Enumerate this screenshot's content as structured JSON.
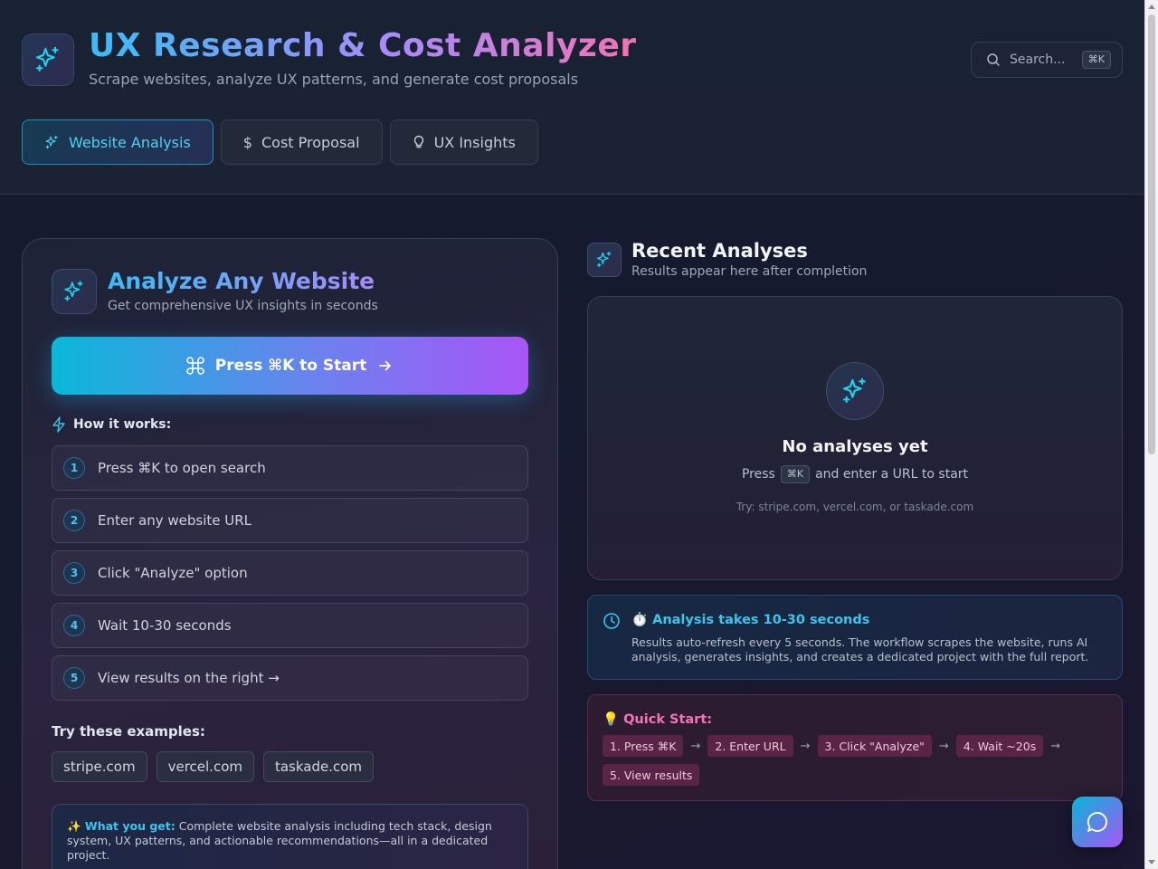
{
  "header": {
    "title": "UX Research & Cost Analyzer",
    "subtitle": "Scrape websites, analyze UX patterns, and generate cost proposals",
    "logo_icon": "sparkles-icon",
    "search": {
      "placeholder": "Search...",
      "shortcut": "⌘K"
    }
  },
  "tabs": [
    {
      "label": "Website Analysis",
      "icon": "sparkles-icon",
      "active": true
    },
    {
      "label": "Cost Proposal",
      "icon": "dollar-icon",
      "active": false
    },
    {
      "label": "UX Insights",
      "icon": "lightbulb-icon",
      "active": false
    }
  ],
  "analyze": {
    "title": "Analyze Any Website",
    "subtitle": "Get comprehensive UX insights in seconds",
    "cta_label": "Press ⌘K to Start",
    "how_label": "How it works:",
    "steps": [
      {
        "num": "1",
        "text": "Press ⌘K to open search"
      },
      {
        "num": "2",
        "text": "Enter any website URL"
      },
      {
        "num": "3",
        "text": "Click \"Analyze\" option"
      },
      {
        "num": "4",
        "text": "Wait 10-30 seconds"
      },
      {
        "num": "5",
        "text": "View results on the right →"
      }
    ],
    "examples_label": "Try these examples:",
    "examples": [
      "stripe.com",
      "vercel.com",
      "taskade.com"
    ],
    "get_label": "✨ What you get:",
    "get_text": "Complete website analysis including tech stack, design system, UX patterns, and actionable recommendations—all in a dedicated project."
  },
  "recent": {
    "title": "Recent Analyses",
    "subtitle": "Results appear here after completion",
    "empty_title": "No analyses yet",
    "empty_hint_pre": "Press",
    "empty_hint_key": "⌘K",
    "empty_hint_post": "and enter a URL to start",
    "empty_try": "Try: stripe.com, vercel.com, or taskade.com"
  },
  "timing": {
    "title": "⏱️ Analysis takes 10-30 seconds",
    "text": "Results auto-refresh every 5 seconds. The workflow scrapes the website, runs AI analysis, generates insights, and creates a dedicated project with the full report."
  },
  "quick_start": {
    "title": "💡 Quick Start:",
    "steps": [
      "1. Press ⌘K",
      "2. Enter URL",
      "3. Click \"Analyze\"",
      "4. Wait ~20s",
      "5. View results"
    ],
    "arrow": "→"
  },
  "colors": {
    "accent_cyan": "#38c6ef",
    "accent_purple": "#a78bfa",
    "accent_pink": "#f472b6"
  }
}
